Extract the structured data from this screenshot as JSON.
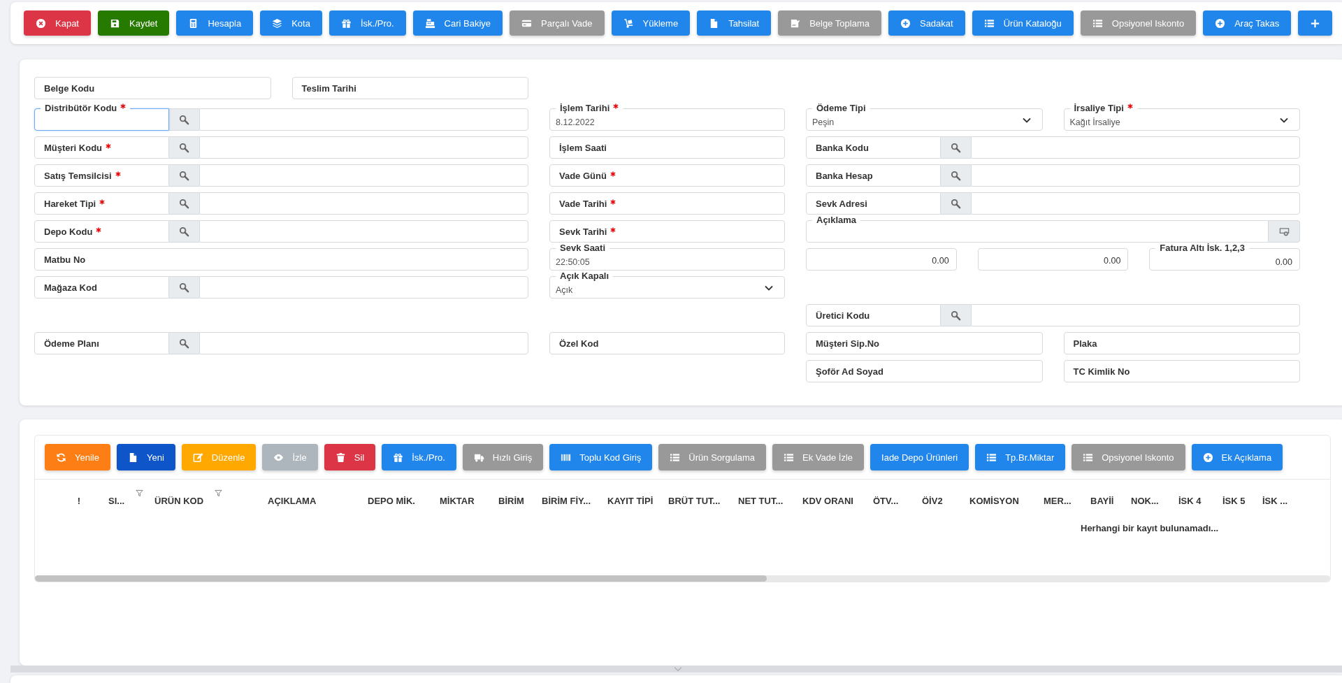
{
  "toolbar": {
    "buttons": [
      {
        "label": "Kapat",
        "kind": "close",
        "color": "#dc3545"
      },
      {
        "label": "Kaydet",
        "kind": "save",
        "color": "#267a00"
      },
      {
        "label": "Hesapla",
        "kind": "calculator",
        "color": "#2186eb"
      },
      {
        "label": "Kota",
        "kind": "layers",
        "color": "#2186eb"
      },
      {
        "label": "İsk./Pro.",
        "kind": "gift",
        "color": "#2186eb"
      },
      {
        "label": "Cari Bakiye",
        "kind": "register",
        "color": "#2186eb"
      },
      {
        "label": "Parçalı Vade",
        "kind": "card",
        "color": "#999999"
      },
      {
        "label": "Yükleme",
        "kind": "dolly",
        "color": "#2186eb"
      },
      {
        "label": "Tahsilat",
        "kind": "file",
        "color": "#2186eb"
      },
      {
        "label": "Belge Toplama",
        "kind": "signature",
        "color": "#999999"
      },
      {
        "label": "Sadakat",
        "kind": "plus-circle",
        "color": "#2186eb"
      },
      {
        "label": "Ürün Kataloğu",
        "kind": "list",
        "color": "#2186eb"
      },
      {
        "label": "Opsiyonel Iskonto",
        "kind": "list",
        "color": "#999999"
      },
      {
        "label": "Araç Takas",
        "kind": "plus-circle",
        "color": "#2186eb"
      },
      {
        "kind": "plus",
        "color": "#2186eb"
      }
    ]
  },
  "form": {
    "rows": [
      {
        "left": [
          {
            "kind": "text",
            "label": "Belge Kodu",
            "required": false,
            "focused": false
          },
          {
            "kind": "text",
            "label": "Teslim Tarihi",
            "required": false,
            "focused": false
          }
        ]
      },
      {
        "left": [
          {
            "kind": "lookup",
            "label": "Distribütör Kodu",
            "required": true,
            "focused": true
          }
        ],
        "middle": [
          {
            "kind": "text",
            "label": "İşlem Tarihi",
            "value": "8.12.2022",
            "required": true,
            "focused": false
          }
        ],
        "right": [
          {
            "kind": "select",
            "label": "Ödeme Tipi",
            "value": "Peşin",
            "required": false,
            "focused": false
          },
          {
            "kind": "select",
            "label": "İrsaliye Tipi",
            "value": "Kağıt İrsaliye",
            "required": true,
            "focused": false
          }
        ]
      },
      {
        "left": [
          {
            "kind": "lookup",
            "label": "Müşteri Kodu",
            "required": true,
            "focused": false
          }
        ],
        "middle": [
          {
            "kind": "text",
            "label": "İşlem Saati",
            "required": false,
            "focused": false
          }
        ],
        "right": [
          {
            "kind": "lookup",
            "label": "Banka Kodu",
            "required": false,
            "focused": false
          }
        ]
      },
      {
        "left": [
          {
            "kind": "lookup",
            "label": "Satış Temsilcisi",
            "required": true,
            "focused": false
          }
        ],
        "middle": [
          {
            "kind": "text",
            "label": "Vade Günü",
            "required": true,
            "focused": false
          }
        ],
        "right": [
          {
            "kind": "lookup",
            "label": "Banka Hesap",
            "required": false,
            "focused": false
          }
        ]
      },
      {
        "left": [
          {
            "kind": "lookup",
            "label": "Hareket Tipi",
            "required": true,
            "focused": false
          }
        ],
        "middle": [
          {
            "kind": "text",
            "label": "Vade Tarihi",
            "required": true,
            "focused": false
          }
        ],
        "right": [
          {
            "kind": "lookup",
            "label": "Sevk Adresi",
            "required": false,
            "focused": false
          }
        ]
      },
      {
        "left": [
          {
            "kind": "lookup",
            "label": "Depo Kodu",
            "required": true,
            "focused": false
          }
        ],
        "middle": [
          {
            "kind": "text",
            "label": "Sevk Tarihi",
            "required": true,
            "focused": false
          }
        ],
        "right": [
          {
            "kind": "memo",
            "label": "Açıklama",
            "required": false,
            "focused": false
          }
        ]
      },
      {
        "left": [
          {
            "kind": "text",
            "label": "Matbu No",
            "required": false,
            "focused": false
          }
        ],
        "middle": [
          {
            "kind": "text",
            "label": "Sevk Saati",
            "value": "22:50:05",
            "required": false,
            "focused": false
          }
        ],
        "right": [
          {
            "kind": "number",
            "value": "0.00",
            "focused": false
          },
          {
            "kind": "number",
            "value": "0.00",
            "focused": false
          },
          {
            "kind": "number",
            "label": "Fatura Altı İsk. 1,2,3",
            "value": "0.00",
            "required": false,
            "focused": false
          }
        ]
      },
      {
        "left": [
          {
            "kind": "lookup",
            "label": "Mağaza Kod",
            "required": false,
            "focused": false
          }
        ],
        "middle": [
          {
            "kind": "select",
            "label": "Açık Kapalı",
            "value": "Açık",
            "required": false,
            "focused": false
          }
        ]
      },
      {
        "right": [
          {
            "kind": "lookup",
            "label": "Üretici Kodu",
            "required": false,
            "focused": false
          }
        ]
      },
      {
        "left": [
          {
            "kind": "lookup",
            "label": "Ödeme Planı",
            "required": false,
            "focused": false
          }
        ],
        "middle": [
          {
            "kind": "text",
            "label": "Özel Kod",
            "required": false,
            "focused": false
          }
        ],
        "right": [
          {
            "kind": "text",
            "label": "Müşteri Sip.No",
            "required": false,
            "focused": false
          },
          {
            "kind": "text",
            "label": "Plaka",
            "required": false,
            "focused": false
          }
        ]
      },
      {
        "right": [
          {
            "kind": "text",
            "label": "Şoför Ad Soyad",
            "required": false,
            "focused": false
          },
          {
            "kind": "text",
            "label": "TC Kimlik No",
            "required": false,
            "focused": false
          }
        ]
      }
    ]
  },
  "grid": {
    "toolbar": {
      "buttons": [
        {
          "label": "Yenile",
          "kind": "refresh",
          "color": "#fd7e14"
        },
        {
          "label": "Yeni",
          "kind": "file",
          "color": "#0d55c8"
        },
        {
          "label": "Düzenle",
          "kind": "edit",
          "color": "#ffa800"
        },
        {
          "label": "İzle",
          "kind": "eye",
          "color": "#adb5bd"
        },
        {
          "label": "Sil",
          "kind": "trash",
          "color": "#dc3545"
        },
        {
          "label": "İsk./Pro.",
          "kind": "gift",
          "color": "#2186eb"
        },
        {
          "label": "Hızlı Giriş",
          "kind": "truck",
          "color": "#999999"
        },
        {
          "label": "Toplu Kod Giriş",
          "kind": "barcode",
          "color": "#2186eb"
        },
        {
          "label": "Ürün Sorgulama",
          "kind": "list",
          "color": "#999999"
        },
        {
          "label": "Ek Vade İzle",
          "kind": "list",
          "color": "#999999"
        },
        {
          "label": "Iade Depo Ürünleri",
          "kind": "text",
          "color": "#2186eb"
        },
        {
          "label": "Tp.Br.Miktar",
          "kind": "list",
          "color": "#2186eb"
        },
        {
          "label": "Opsiyonel Iskonto",
          "kind": "list",
          "color": "#999999"
        },
        {
          "label": "Ek Açıklama",
          "kind": "plus-circle",
          "color": "#2186eb"
        }
      ]
    },
    "columns": [
      {
        "label": "!",
        "filterable": false
      },
      {
        "label": "SI...",
        "filterable": true
      },
      {
        "label": "ÜRÜN KOD",
        "filterable": true
      },
      {
        "label": "AÇIKLAMA",
        "filterable": false
      },
      {
        "label": "DEPO MİK.",
        "filterable": false
      },
      {
        "label": "MİKTAR",
        "filterable": false
      },
      {
        "label": "BİRİM",
        "filterable": false
      },
      {
        "label": "BİRİM FİY...",
        "filterable": false
      },
      {
        "label": "KAYIT TİPİ",
        "filterable": false
      },
      {
        "label": "BRÜT TUT...",
        "filterable": false
      },
      {
        "label": "NET TUT...",
        "filterable": false
      },
      {
        "label": "KDV ORANI",
        "filterable": false
      },
      {
        "label": "ÖTV...",
        "filterable": false
      },
      {
        "label": "ÖİV2",
        "filterable": false
      },
      {
        "label": "KOMİSYON",
        "filterable": false
      },
      {
        "label": "MER...",
        "filterable": false
      },
      {
        "label": "BAYİİ",
        "filterable": false
      },
      {
        "label": "NOK...",
        "filterable": false
      },
      {
        "label": "İSK 4",
        "filterable": false
      },
      {
        "label": "İSK 5",
        "filterable": false
      },
      {
        "label": "İSK ...",
        "filterable": false
      }
    ],
    "empty_message": "Herhangi bir kayıt bulunamadı..."
  }
}
